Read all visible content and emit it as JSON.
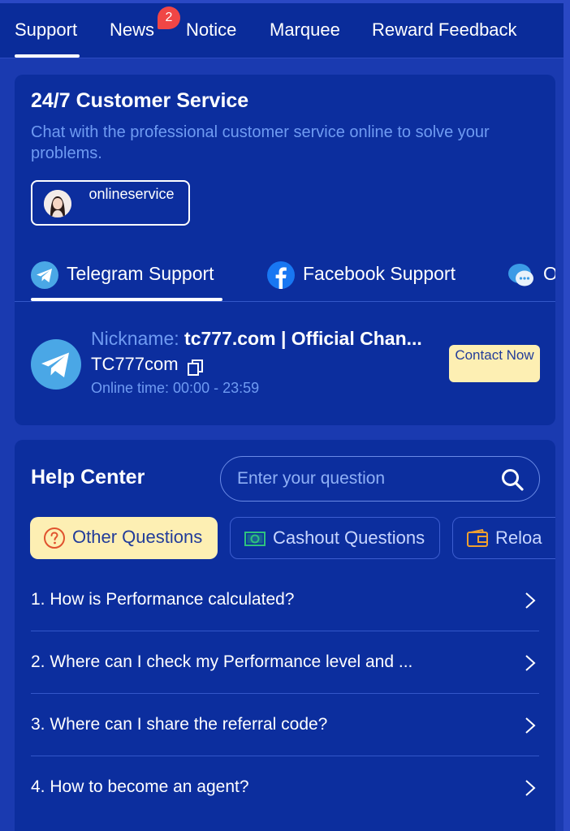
{
  "top_tabs": [
    {
      "label": "Support",
      "active": true
    },
    {
      "label": "News",
      "badge": "2"
    },
    {
      "label": "Notice"
    },
    {
      "label": "Marquee"
    },
    {
      "label": "Reward Feedback"
    }
  ],
  "customer_service": {
    "title": "24/7 Customer Service",
    "subtitle": "Chat with the professional customer service online to solve your problems.",
    "online_service_label": "onlineservice"
  },
  "support_tabs": [
    {
      "label": "Telegram Support",
      "icon": "telegram-icon",
      "active": true
    },
    {
      "label": "Facebook Support",
      "icon": "facebook-icon"
    },
    {
      "label": "O",
      "icon": "chat-bubble-icon"
    }
  ],
  "channel": {
    "nickname_key": "Nickname:",
    "nickname_value": "tc777.com | Official Chan...",
    "account": "TC777com",
    "online_time": "Online time: 00:00 - 23:59",
    "contact_label": "Contact Now"
  },
  "help_center": {
    "title": "Help Center",
    "search_placeholder": "Enter your question",
    "categories": [
      {
        "label": "Other Questions",
        "icon": "question-icon",
        "active": true
      },
      {
        "label": "Cashout Questions",
        "icon": "cashout-icon"
      },
      {
        "label": "Reloa",
        "icon": "wallet-icon"
      }
    ],
    "faqs": [
      "1. How is Performance calculated?",
      "2. Where can I check my Performance level and ...",
      "3. Where can I share the referral code?",
      "4. How to become an agent?"
    ]
  },
  "colors": {
    "background": "#1a3ab0",
    "card": "#0c2e9e",
    "accent_yellow": "#fdefb3",
    "muted_blue": "#6f9bf2",
    "badge_red": "#f04646"
  }
}
